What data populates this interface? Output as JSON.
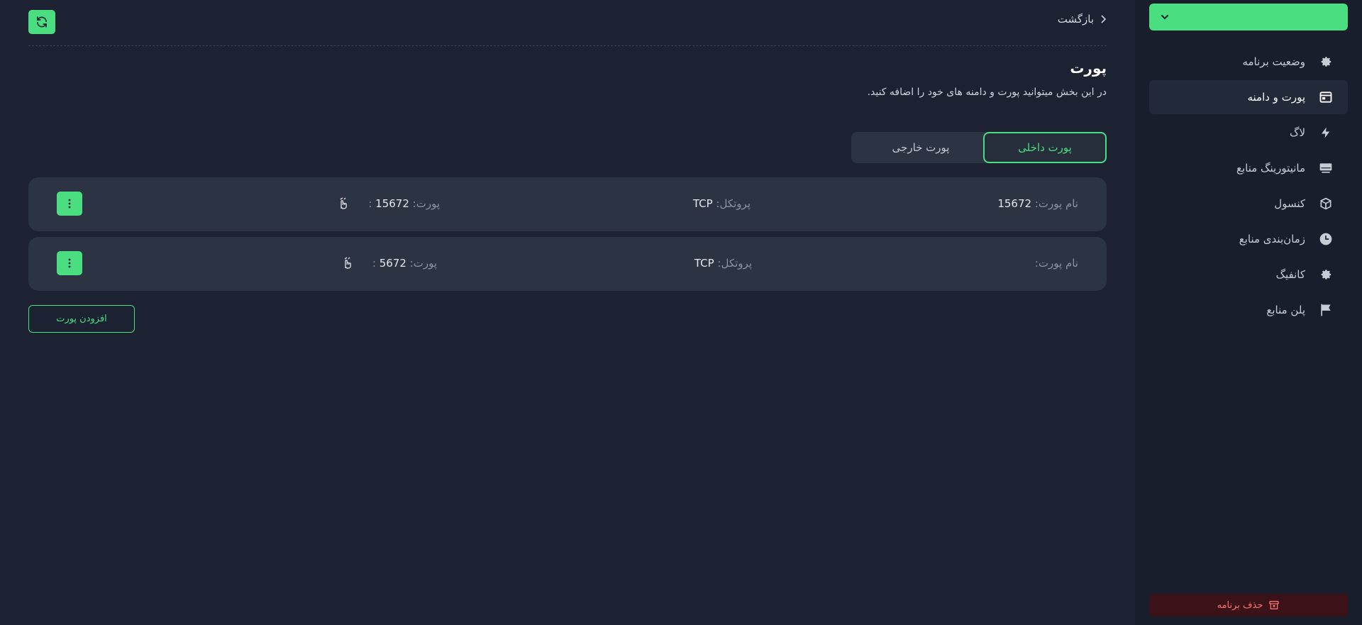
{
  "header": {
    "back_label": "بازگشت"
  },
  "page": {
    "title": "پورت",
    "description": "در این بخش میتوانید پورت و دامنه های خود را اضافه کنید."
  },
  "tabs": [
    {
      "label": "پورت داخلی",
      "active": true
    },
    {
      "label": "پورت خارجی",
      "active": false
    }
  ],
  "ports": [
    {
      "name_label": "نام پورت:",
      "name": "15672",
      "protocol_label": "پروتکل:",
      "protocol": "TCP",
      "port_label": "پورت:",
      "port": "15672",
      "suffix": ":"
    },
    {
      "name_label": "نام پورت:",
      "name": "",
      "protocol_label": "پروتکل:",
      "protocol": "TCP",
      "port_label": "پورت:",
      "port": "5672",
      "suffix": ":"
    }
  ],
  "add_port_label": "افزودن پورت",
  "sidebar": {
    "items": [
      {
        "label": "وضعیت برنامه",
        "icon": "gear-icon"
      },
      {
        "label": "پورت و دامنه",
        "icon": "window-icon",
        "active": true
      },
      {
        "label": "لاگ",
        "icon": "bolt-icon"
      },
      {
        "label": "مانیتورینگ منابع",
        "icon": "monitor-icon"
      },
      {
        "label": "کنسول",
        "icon": "cube-icon"
      },
      {
        "label": "زمان‌بندی منابع",
        "icon": "clock-icon"
      },
      {
        "label": "کانفیگ",
        "icon": "gear-icon"
      },
      {
        "label": "پلن منابع",
        "icon": "flag-icon"
      }
    ],
    "delete_label": "حذف برنامه"
  },
  "colors": {
    "accent": "#4ade80",
    "background": "#1c2232",
    "sidebar": "#181e2c",
    "card": "#2c3342",
    "danger": "#f87171"
  }
}
